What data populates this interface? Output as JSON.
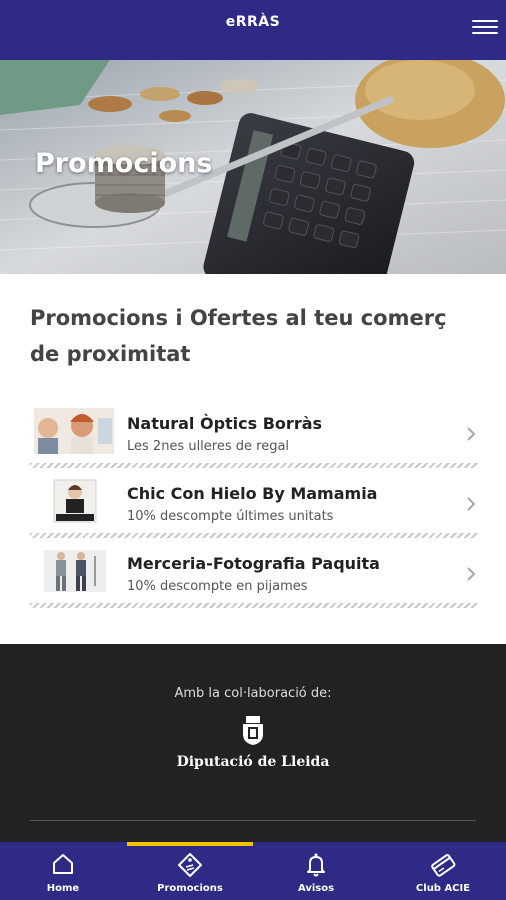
{
  "header": {
    "title": "eRRÀS",
    "menu_icon": "hamburger-menu-icon"
  },
  "hero": {
    "title": "Promocions"
  },
  "section": {
    "heading": "Promocions i Ofertes al teu comerç de proximitat"
  },
  "promotions": [
    {
      "name": "Natural Òptics Borràs",
      "description": "Les 2nes ulleres de regal"
    },
    {
      "name": "Chic Con Hielo By Mamamia",
      "description": "10% descompte últimes unitats"
    },
    {
      "name": "Merceria-Fotografia Paquita",
      "description": "10% descompte en pijames"
    }
  ],
  "footer": {
    "collab_label": "Amb la col·laboració de:",
    "organization": "Diputació de Lleida"
  },
  "nav": {
    "items": [
      {
        "label": "Home",
        "icon": "home-icon"
      },
      {
        "label": "Promocions",
        "icon": "tag-icon",
        "active": true
      },
      {
        "label": "Avisos",
        "icon": "bell-icon"
      },
      {
        "label": "Club ACIE",
        "icon": "card-icon"
      }
    ]
  },
  "colors": {
    "primary": "#2e2a86",
    "accent": "#f2c200",
    "footer_bg": "#222222"
  }
}
